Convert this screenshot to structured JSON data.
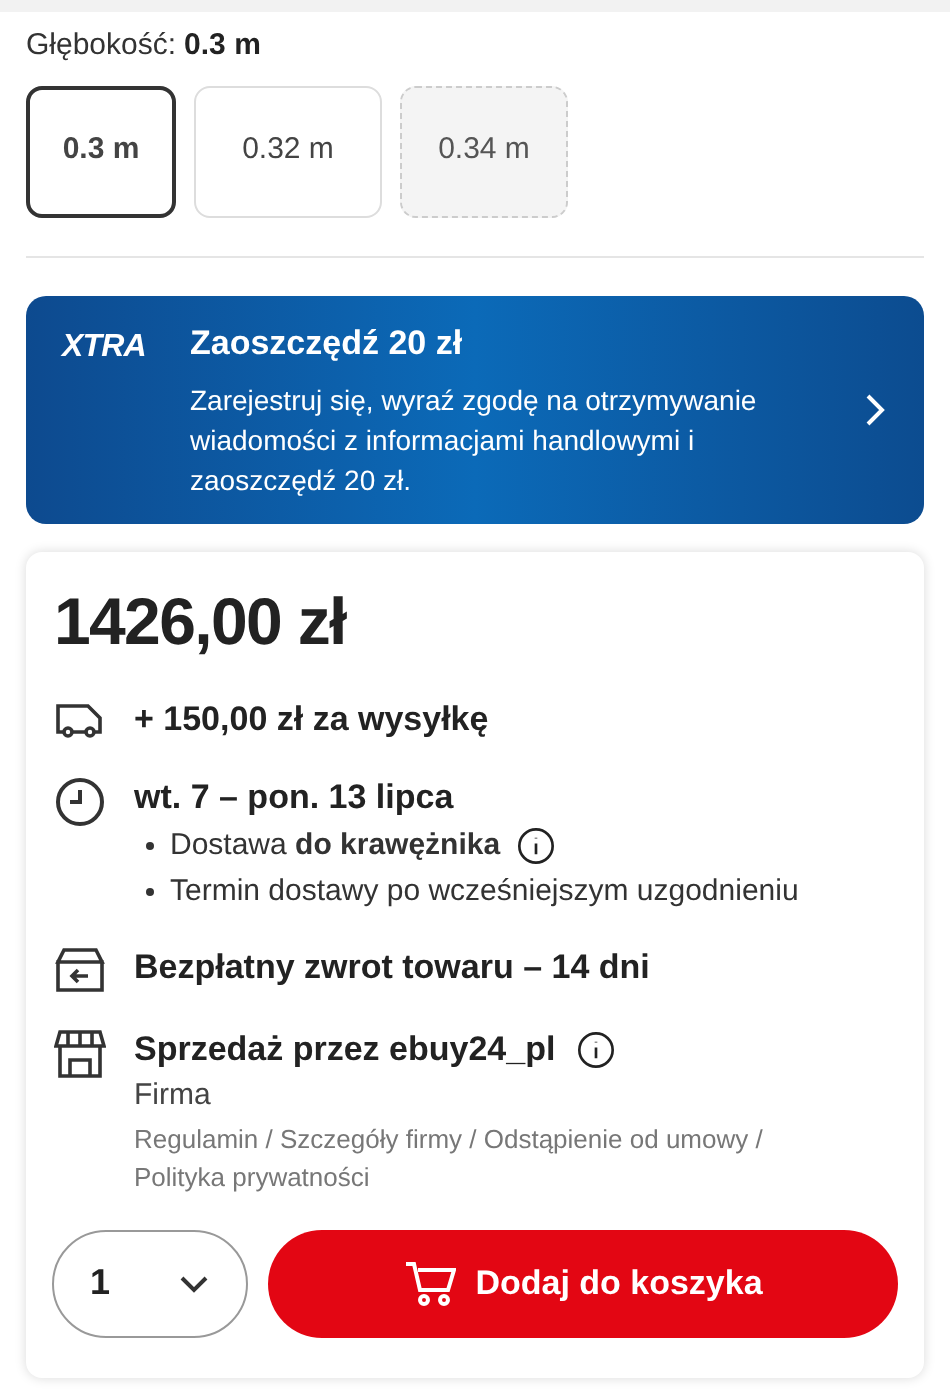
{
  "depth": {
    "label": "Głębokość:",
    "value": "0.3 m",
    "options": [
      {
        "label": "0.3 m",
        "selected": true,
        "disabled": false
      },
      {
        "label": "0.32 m",
        "selected": false,
        "disabled": false
      },
      {
        "label": "0.34 m",
        "selected": false,
        "disabled": true
      }
    ]
  },
  "promo": {
    "logo": "XTRA",
    "title": "Zaoszczędź 20 zł",
    "text": "Zarejestruj się, wyraź zgodę na otrzymywanie wiadomości z informacjami handlowymi i zaoszczędź 20 zł."
  },
  "offer": {
    "price": "1426,00 zł",
    "rows": [
      {
        "kind": "shipping",
        "title": "+ 150,00 zł za wysyłkę"
      },
      {
        "kind": "delivery",
        "title": "wt. 7 – pon. 13 lipca",
        "bullets": [
          {
            "text": "Dostawa **do krawężnika**",
            "info": true
          },
          {
            "text": "Termin dostawy po wcześniejszym uzgodnieniu",
            "info": false
          }
        ]
      },
      {
        "kind": "return",
        "title": "Bezpłatny zwrot towaru – 14 dni"
      },
      {
        "kind": "seller",
        "title": "Sprzedaż przez ebuy24_pl",
        "info": true,
        "subtitle": "Firma",
        "link_separator": "/",
        "links": [
          "Regulamin",
          "Szczegóły firmy",
          "Odstąpienie od umowy",
          "Polityka prywatności"
        ]
      }
    ],
    "quantity": "1",
    "button": "Dodaj do koszyka"
  }
}
